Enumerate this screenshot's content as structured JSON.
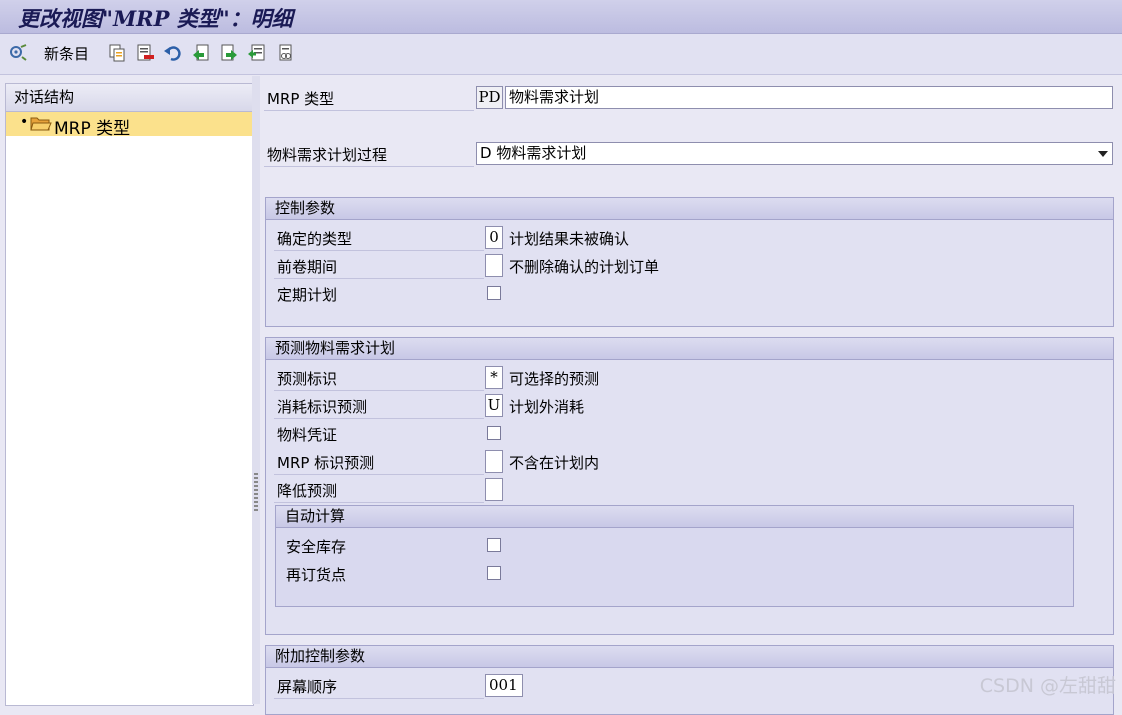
{
  "window": {
    "title": "更改视图\"MRP 类型\"：明细"
  },
  "toolbar": {
    "new_entries_label": "新条目",
    "icons": [
      "change-display-icon",
      "copy-icon",
      "delete-icon",
      "undo-icon",
      "previous-entry-icon",
      "next-entry-icon",
      "select-all-icon",
      "print-icon"
    ]
  },
  "nav": {
    "header": "对话结构",
    "items": [
      {
        "label": "MRP 类型",
        "icon": "folder-open-icon",
        "selected": true
      }
    ]
  },
  "header_fields": {
    "mrp_type_label": "MRP 类型",
    "mrp_type_code": "PD",
    "mrp_type_desc": "物料需求计划",
    "procedure_label": "物料需求计划过程",
    "procedure_value": "D 物料需求计划"
  },
  "control_params": {
    "title": "控制参数",
    "firming_type_label": "确定的类型",
    "firming_type_value": "0",
    "firming_type_desc": "计划结果未被确认",
    "rollforward_label": "前卷期间",
    "rollforward_value": "",
    "rollforward_desc": "不删除确认的计划订单",
    "periodic_label": "定期计划",
    "periodic_checked": false
  },
  "forecast": {
    "title": "预测物料需求计划",
    "ind_label": "预测标识",
    "ind_value": "*",
    "ind_desc": "可选择的预测",
    "cons_label": "消耗标识预测",
    "cons_value": "U",
    "cons_desc": "计划外消耗",
    "doc_label": "物料凭证",
    "doc_checked": false,
    "mrp_ind_label": "MRP 标识预测",
    "mrp_ind_value": "",
    "mrp_ind_desc": "不含在计划内",
    "reduce_label": "降低预测",
    "reduce_value": "",
    "auto_calc": {
      "title": "自动计算",
      "safety_label": "安全库存",
      "safety_checked": false,
      "reorder_label": "再订货点",
      "reorder_checked": false
    }
  },
  "additional": {
    "title": "附加控制参数",
    "screen_seq_label": "屏幕顺序",
    "screen_seq_value": "001"
  },
  "watermark": "CSDN @左甜甜",
  "colors": {
    "nav_selected": "#fbe18c",
    "title_text": "#1a1a55",
    "group_bg": "#e1e1f2"
  }
}
